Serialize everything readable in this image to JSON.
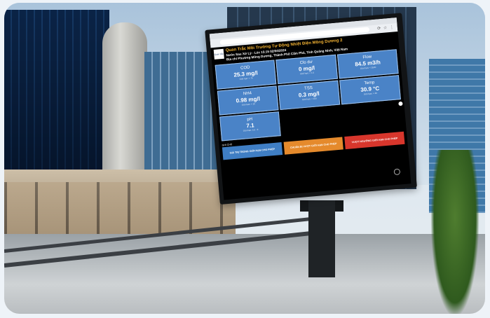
{
  "browser": {
    "url": "",
    "toolbar_icons": "⟳ ☆ ⋮"
  },
  "station": {
    "logo_text": "Quan trắc",
    "title": "Quan Trắc Môi Trường Tự Động Nhiệt Điện Mông Dương 2",
    "line1": "Nước Sau Xử Lý - Lúc 15:15 02/04/2024",
    "line2": "Địa chỉ Phường Mông Dương, Thành Phố Cẩm Phả, Tỉnh Quảng Ninh, Việt Nam"
  },
  "metrics": [
    {
      "name": "COD",
      "value": "25.3 mg/l",
      "limit": "Giới hạn: < 75"
    },
    {
      "name": "Clo dư",
      "value": "0 mg/l",
      "limit": "Giới hạn: < 1.0"
    },
    {
      "name": "Flow",
      "value": "84.5 m3/h",
      "limit": "Giới hạn: < 3500"
    },
    {
      "name": "NH4",
      "value": "0.98 mg/l",
      "limit": "Giới hạn: < 10"
    },
    {
      "name": "TSS",
      "value": "0.3 mg/l",
      "limit": "Giới hạn: < 100"
    },
    {
      "name": "Temp",
      "value": "30.9 °C",
      "limit": "Giới hạn: < 40"
    },
    {
      "name": "pH",
      "value": "7.1",
      "limit": "Giới hạn: 5.5 - 9"
    }
  ],
  "legend": {
    "title": "GHI CHÚ",
    "items": [
      {
        "label": "GIÁ TRỊ TRONG GIỚI HẠN CHO PHÉP",
        "color": "#3f7ec4"
      },
      {
        "label": "CHUẨN BỊ VƯỢT GIỚI HẠN CHO PHÉP",
        "color": "#e58a2c"
      },
      {
        "label": "VƯỢT NGƯỠNG GIỚI HẠN CHO PHÉP",
        "color": "#d8362c"
      }
    ]
  }
}
